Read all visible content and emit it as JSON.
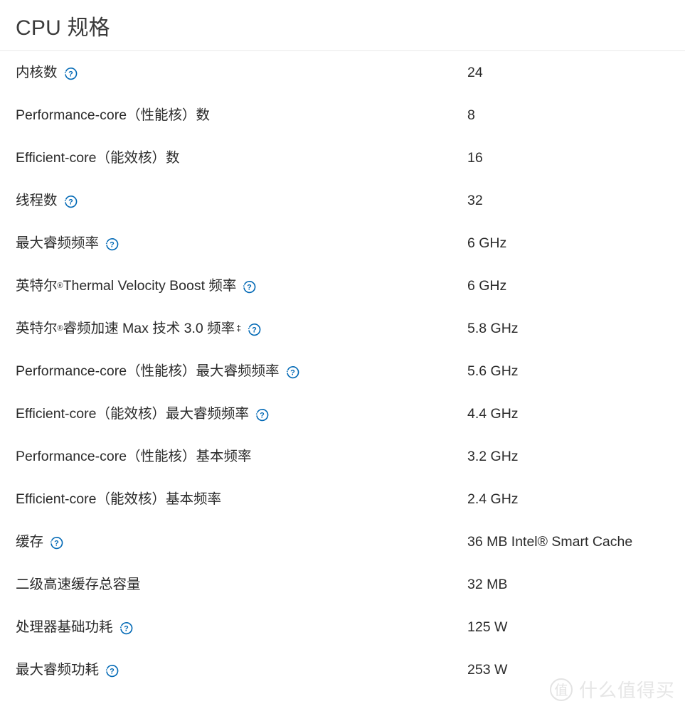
{
  "panel": {
    "title": "CPU 规格",
    "accent_blue": "#0068b5",
    "text_color": "#2b2b2b",
    "title_color": "#3b3b3b",
    "divider_color": "#e9e9e9",
    "background": "#ffffff"
  },
  "help_icon_name": "help-circle-icon",
  "specs": [
    {
      "label_pre": "内核数",
      "label_post": "",
      "has_help": true,
      "has_reg": false,
      "has_dagger": false,
      "value": "24"
    },
    {
      "label_pre": "Performance-core（性能核）数",
      "label_post": "",
      "has_help": false,
      "has_reg": false,
      "has_dagger": false,
      "value": "8"
    },
    {
      "label_pre": "Efficient-core（能效核）数",
      "label_post": "",
      "has_help": false,
      "has_reg": false,
      "has_dagger": false,
      "value": "16"
    },
    {
      "label_pre": "线程数",
      "label_post": "",
      "has_help": true,
      "has_reg": false,
      "has_dagger": false,
      "value": "32"
    },
    {
      "label_pre": "最大睿频频率",
      "label_post": "",
      "has_help": true,
      "has_reg": false,
      "has_dagger": false,
      "value": "6 GHz"
    },
    {
      "label_pre": "英特尔",
      "label_post": " Thermal Velocity Boost 频率",
      "has_help": true,
      "has_reg": true,
      "has_dagger": false,
      "value": "6 GHz"
    },
    {
      "label_pre": "英特尔",
      "label_post": " 睿频加速 Max 技术 3.0 频率",
      "has_help": true,
      "has_reg": true,
      "has_dagger": true,
      "value": "5.8 GHz"
    },
    {
      "label_pre": "Performance-core（性能核）最大睿频频率",
      "label_post": "",
      "has_help": true,
      "has_reg": false,
      "has_dagger": false,
      "value": "5.6 GHz"
    },
    {
      "label_pre": "Efficient-core（能效核）最大睿频频率",
      "label_post": "",
      "has_help": true,
      "has_reg": false,
      "has_dagger": false,
      "value": "4.4 GHz"
    },
    {
      "label_pre": "Performance-core（性能核）基本频率",
      "label_post": "",
      "has_help": false,
      "has_reg": false,
      "has_dagger": false,
      "value": "3.2 GHz"
    },
    {
      "label_pre": "Efficient-core（能效核）基本频率",
      "label_post": "",
      "has_help": false,
      "has_reg": false,
      "has_dagger": false,
      "value": "2.4 GHz"
    },
    {
      "label_pre": "缓存",
      "label_post": "",
      "has_help": true,
      "has_reg": false,
      "has_dagger": false,
      "value": "36 MB Intel® Smart Cache"
    },
    {
      "label_pre": "二级高速缓存总容量",
      "label_post": "",
      "has_help": false,
      "has_reg": false,
      "has_dagger": false,
      "value": "32 MB"
    },
    {
      "label_pre": "处理器基础功耗",
      "label_post": "",
      "has_help": true,
      "has_reg": false,
      "has_dagger": false,
      "value": "125 W"
    },
    {
      "label_pre": "最大睿频功耗",
      "label_post": "",
      "has_help": true,
      "has_reg": false,
      "has_dagger": false,
      "value": "253 W"
    }
  ],
  "watermark": {
    "badge": "值",
    "text": "什么值得买"
  },
  "symbols": {
    "registered": "®",
    "dagger": "‡"
  }
}
